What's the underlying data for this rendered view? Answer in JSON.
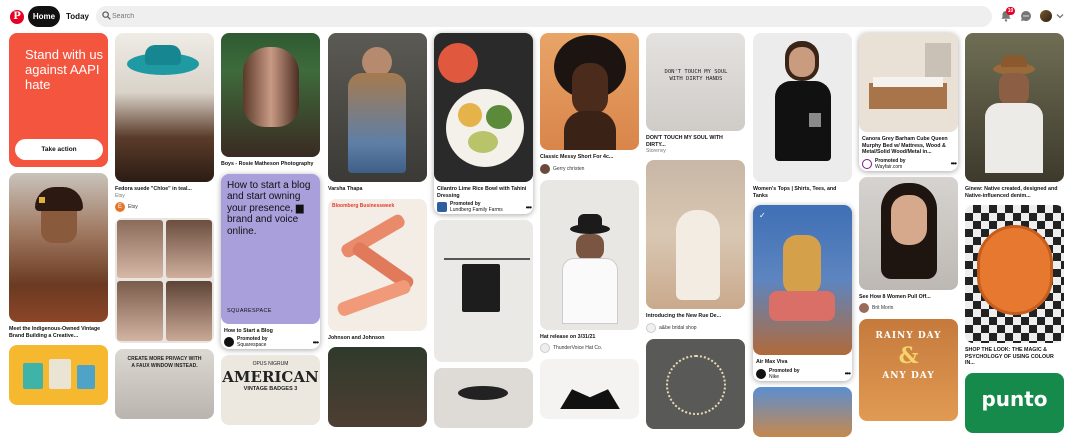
{
  "header": {
    "home_label": "Home",
    "today_label": "Today",
    "search_placeholder": "Search",
    "notification_count": "10"
  },
  "colors": {
    "brand": "#e60023",
    "aapi_bg": "#f4553f",
    "squarespace_bg": "#a89fdb"
  },
  "icons": [
    "pinterest-logo-icon",
    "search-icon",
    "bell-icon",
    "chat-icon",
    "chevron-down-icon",
    "more-icon"
  ],
  "pins": {
    "aapi": {
      "text": "Stand with us against AAPI hate",
      "button": "Take action"
    },
    "indigenous": {
      "title": "Meet the Indigenous-Owned Vintage Brand Building a Creative..."
    },
    "fedora": {
      "title": "Fedora suede \"Chloe\" in teal...",
      "source": "Etsy",
      "user": "Etsy",
      "user_initial": "E"
    },
    "privacy": {
      "line1": "CREATE MORE PRIVACY WITH",
      "line2": "A FAUX WINDOW INSTEAD."
    },
    "boys": {
      "title": "Boys - Rosie Matheson Photography"
    },
    "squarespace": {
      "text": "How to start a blog and start owning your presence, ▆ brand and voice online.",
      "brand": "SQUARESPACE",
      "title": "How to Start a Blog",
      "promoted": "Promoted by",
      "by": "Squarespace"
    },
    "american": {
      "line1": "OPUS NIGRUM",
      "line2": "AMERICAN",
      "line3": "VINTAGE BADGES 3"
    },
    "varsha": {
      "title": "Varsha Thapa"
    },
    "johnson": {
      "title": "Johnson and Johnson",
      "brand": "Bloomberg Businessweek"
    },
    "cilantro": {
      "title": "Cilantro Lime Rice Bowl with Tahini Dressing",
      "promoted": "Promoted by",
      "by": "Lundberg Family Farms"
    },
    "messy": {
      "title": "Classic Messy Short For 4c...",
      "user": "Gerry christen"
    },
    "hat": {
      "title": "Hat release on 3/31/21",
      "user": "ThunderVoice Hat Co."
    },
    "dont_touch": {
      "title": "DON'T TOUCH MY SOUL WITH DIRTY...",
      "source": "Storenvy",
      "hat_text": "DON'T TOUCH MY SOUL WITH DIRTY HANDS"
    },
    "rue": {
      "title": "Introducing the New Rue De...",
      "user": "a&be bridal shop"
    },
    "womens": {
      "title": "Women's Tops | Shirts, Tees, and Tanks"
    },
    "airmax": {
      "title": "Air Max Viva",
      "promoted": "Promoted by",
      "by": "Nike"
    },
    "canora": {
      "title": "Canora Grey Barham Cube Queen Murphy Bed w/ Mattress, Wood & Metal/Solid Wood/Metal in...",
      "promoted": "Promoted by",
      "by": "Wayfair.com"
    },
    "women8": {
      "title": "See How 8 Women Pull Off...",
      "user": "Brit Morin"
    },
    "rainy": {
      "line1": "RAINY DAY",
      "amp": "&",
      "line2": "ANY DAY"
    },
    "ginew": {
      "title": "Ginew: Native created, designed and Native-influenced denim..."
    },
    "shop": {
      "title": "SHOP THE LOOK: THE MAGIC & PSYCHOLOGY OF USING COLOUR IN..."
    },
    "punto": {
      "text": "punto"
    }
  }
}
